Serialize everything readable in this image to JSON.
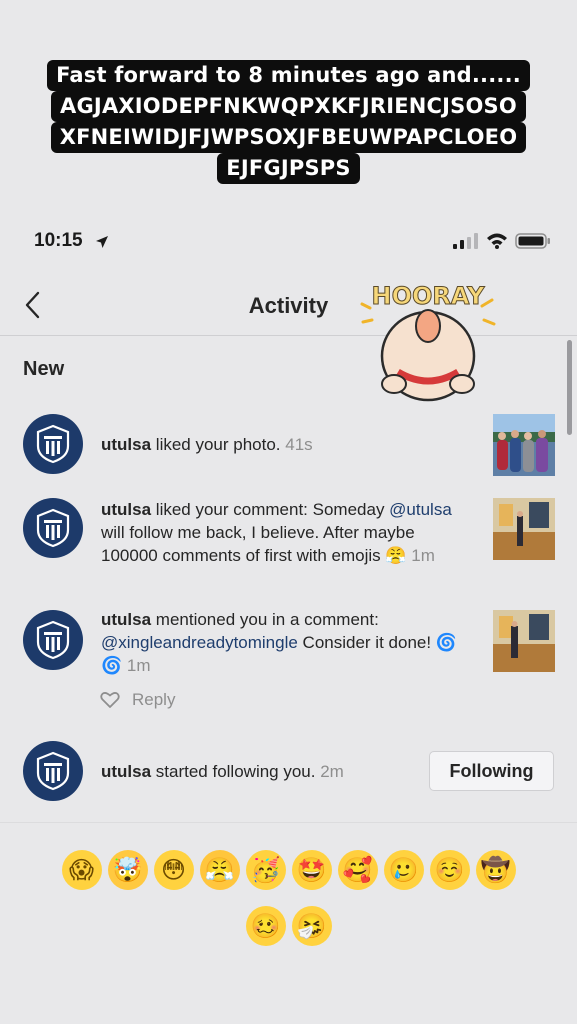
{
  "caption": {
    "lines": [
      "Fast forward to 8 minutes ago and......",
      "AGJAXIODEPFNKWQPXKFJRIENCJSOSO",
      "XFNEIWIDJFJWPSOXJFBEUWPAPCLOEO",
      "EJFGJPSPS"
    ]
  },
  "status_bar": {
    "time": "10:15"
  },
  "header": {
    "title": "Activity",
    "back_icon": "chevron-left-icon"
  },
  "sticker": {
    "text": "HOORAY"
  },
  "section_label": "New",
  "activities": [
    {
      "user": "utulsa",
      "text": " liked your photo. ",
      "time": "41s"
    },
    {
      "user": "utulsa",
      "text": " liked your comment: Someday ",
      "mention": "@utulsa",
      "text2": " will follow me back, I believe. After maybe 100000 comments of first with emojis 😤 ",
      "time": "1m"
    },
    {
      "user": "utulsa",
      "text": " mentioned you in a comment: ",
      "mention": "@xingleandreadytomingle",
      "text2": " Consider it done! 🌀 🌀 ",
      "time": "1m"
    },
    {
      "user": "utulsa",
      "text": " started following you. ",
      "time": "2m"
    }
  ],
  "reply_label": "Reply",
  "following_label": "Following",
  "emoji_rows": [
    [
      "😱",
      "🤯",
      "😳",
      "😤",
      "🥳",
      "🤩",
      "🥰",
      "🥲",
      "☺️",
      "🤠"
    ],
    [
      "🥴",
      "🤧"
    ]
  ],
  "colors": {
    "avatar_bg": "#1d3a6a",
    "mention": "#1f3e6e",
    "muted": "#8e8e8e",
    "caption_bg": "#0d0d0d"
  }
}
